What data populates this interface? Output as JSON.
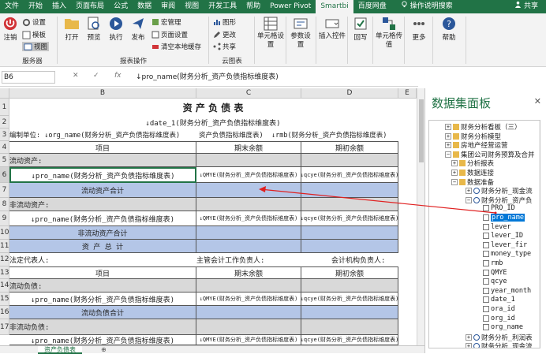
{
  "tabs": [
    "文件",
    "开始",
    "插入",
    "页面布局",
    "公式",
    "数据",
    "审阅",
    "视图",
    "开发工具",
    "帮助",
    "Power Pivot",
    "Smartbi",
    "百度网盘"
  ],
  "active_tab": "Smartbi",
  "tell_me": "操作说明搜索",
  "share": "共享",
  "ribbon": {
    "logout": "注销",
    "settings": "设置",
    "template": "模板",
    "view": "视图",
    "server_group": "服务器",
    "open": "打开",
    "preview": "预览",
    "execute": "执行",
    "publish": "发布",
    "macro": "宏管理",
    "page_setup": "页面设置",
    "clear_cache": "清空本地缓存",
    "report_group": "报表操作",
    "shape": "图形",
    "change": "更改",
    "share": "共享",
    "cloud_group": "云图表",
    "cell_settings": "单元格设置",
    "params": "参数设置",
    "insert_control": "插入控件",
    "writeback": "回写",
    "cell_pass": "单元格传值",
    "more": "更多",
    "help": "帮助"
  },
  "formula": {
    "cell_ref": "B6",
    "content": "↓pro_name(财务分析_资产负债指标维度表)"
  },
  "columns": [
    "B",
    "C",
    "D",
    "E"
  ],
  "rows": [
    "1",
    "2",
    "3",
    "4",
    "5",
    "6",
    "7",
    "8",
    "9",
    "10",
    "11",
    "12",
    "13",
    "14",
    "15",
    "16",
    "17"
  ],
  "sheet": {
    "title": "资 产 负 债 表",
    "date": "↓date_1(财务分析_资产负债指标维度表)",
    "r3_a": "编制单位:  ↓org_name(财务分析_资产负债指标维度表)",
    "r3_b": "资产负债指标维度表)",
    "r3_c": "↓rmb(财务分析_资产负债指标维度表)",
    "item": "项目",
    "end_balance": "期末余额",
    "begin_balance": "期初余额",
    "current_assets": "流动资产:",
    "pro_name": "↓pro_name(财务分析_资产负债指标维度表)",
    "qmye": "↓QMYE(财务分析_资产负债指标维度表)",
    "qcye": "↓qcye(财务分析_资产负债指标维度表)",
    "current_assets_total": "流动资产合计",
    "noncurrent_assets": "非流动资产:",
    "noncurrent_assets_total": "非流动资产合计",
    "assets_total": "资 产 总 计",
    "legal_rep": "法定代表人:",
    "accounting_head": "主管会计工作负责人:",
    "accounting_org": "会计机构负责人:",
    "current_liab": "流动负债:",
    "current_liab_total": "流动负债合计",
    "noncurrent_liab": "非流动负债:"
  },
  "sheet_tab": "资产负债表",
  "panel": {
    "title": "数据集面板",
    "close": "✕",
    "items": [
      {
        "label": "财务分析看板（三）",
        "type": "folder"
      },
      {
        "label": "财务分析模型",
        "type": "folder"
      },
      {
        "label": "房地产经营运营",
        "type": "folder"
      },
      {
        "label": "集团公司财务预算及合并",
        "type": "folder"
      },
      {
        "label": "分析报表",
        "type": "folder"
      },
      {
        "label": "数据连接",
        "type": "folder"
      },
      {
        "label": "数据准备",
        "type": "folder"
      },
      {
        "label": "财务分析_现金流",
        "type": "dataset"
      },
      {
        "label": "财务分析_资产负",
        "type": "dataset"
      },
      {
        "label": "PRO_ID",
        "type": "field"
      },
      {
        "label": "pro_name",
        "type": "field",
        "selected": true
      },
      {
        "label": "lever",
        "type": "field"
      },
      {
        "label": "lever_ID",
        "type": "field"
      },
      {
        "label": "lever_fir",
        "type": "field"
      },
      {
        "label": "money_type",
        "type": "field"
      },
      {
        "label": "rmb",
        "type": "field"
      },
      {
        "label": "QMYE",
        "type": "field"
      },
      {
        "label": "qcye",
        "type": "field"
      },
      {
        "label": "year_month",
        "type": "field"
      },
      {
        "label": "date_1",
        "type": "field"
      },
      {
        "label": "ora_id",
        "type": "field"
      },
      {
        "label": "org_id",
        "type": "field"
      },
      {
        "label": "org_name",
        "type": "field"
      },
      {
        "label": "财务分析_利润表",
        "type": "dataset"
      },
      {
        "label": "财务分析_现金流",
        "type": "dataset"
      }
    ]
  }
}
